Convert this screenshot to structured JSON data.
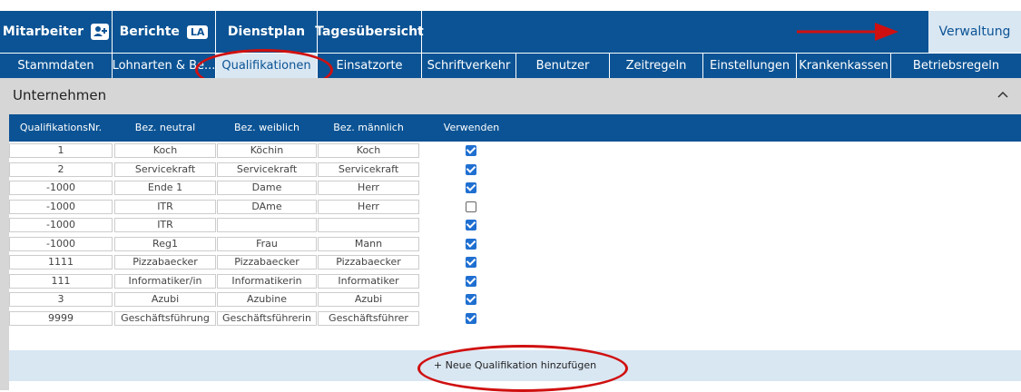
{
  "nav": {
    "mitarbeiter": "Mitarbeiter",
    "berichte": "Berichte",
    "berichte_badge": "LA",
    "dienstplan": "Dienstplan",
    "tagesuebersicht": "Tagesübersicht",
    "verwaltung": "Verwaltung"
  },
  "subnav": {
    "stammdaten": "Stammdaten",
    "lohnarten": "Lohnarten & Be...",
    "qualifikationen": "Qualifikationen",
    "einsatzorte": "Einsatzorte",
    "schriftverkehr": "Schriftverkehr",
    "benutzer": "Benutzer",
    "zeitregeln": "Zeitregeln",
    "einstellungen": "Einstellungen",
    "krankenkassen": "Krankenkassen",
    "betriebsregeln": "Betriebsregeln"
  },
  "section": {
    "title": "Unternehmen",
    "collapse_icon": "chevron-up-icon"
  },
  "table": {
    "headers": [
      "QualifikationsNr.",
      "Bez. neutral",
      "Bez. weiblich",
      "Bez. männlich",
      "Verwenden"
    ],
    "rows": [
      {
        "nr": "1",
        "neutral": "Koch",
        "weiblich": "Köchin",
        "maennlich": "Koch",
        "use": true
      },
      {
        "nr": "2",
        "neutral": "Servicekraft",
        "weiblich": "Servicekraft",
        "maennlich": "Servicekraft",
        "use": true
      },
      {
        "nr": "-1000",
        "neutral": "Ende 1",
        "weiblich": "Dame",
        "maennlich": "Herr",
        "use": true
      },
      {
        "nr": "-1000",
        "neutral": "ITR",
        "weiblich": "DAme",
        "maennlich": "Herr",
        "use": false
      },
      {
        "nr": "-1000",
        "neutral": "ITR",
        "weiblich": "",
        "maennlich": "",
        "use": true
      },
      {
        "nr": "-1000",
        "neutral": "Reg1",
        "weiblich": "Frau",
        "maennlich": "Mann",
        "use": true
      },
      {
        "nr": "1111",
        "neutral": "Pizzabaecker",
        "weiblich": "Pizzabaecker",
        "maennlich": "Pizzabaecker",
        "use": true
      },
      {
        "nr": "111",
        "neutral": "Informatiker/in",
        "weiblich": "Informatikerin",
        "maennlich": "Informatiker",
        "use": true
      },
      {
        "nr": "3",
        "neutral": "Azubi",
        "weiblich": "Azubine",
        "maennlich": "Azubi",
        "use": true
      },
      {
        "nr": "9999",
        "neutral": "Geschäftsführung",
        "weiblich": "Geschäftsführerin",
        "maennlich": "Geschäftsführer",
        "use": true
      }
    ]
  },
  "add_button": "+ Neue Qualifikation hinzufügen",
  "colors": {
    "primary": "#0b5394",
    "active_tab": "#d9e7f3",
    "annotation": "#d01010",
    "checkbox": "#1f6fd1"
  }
}
